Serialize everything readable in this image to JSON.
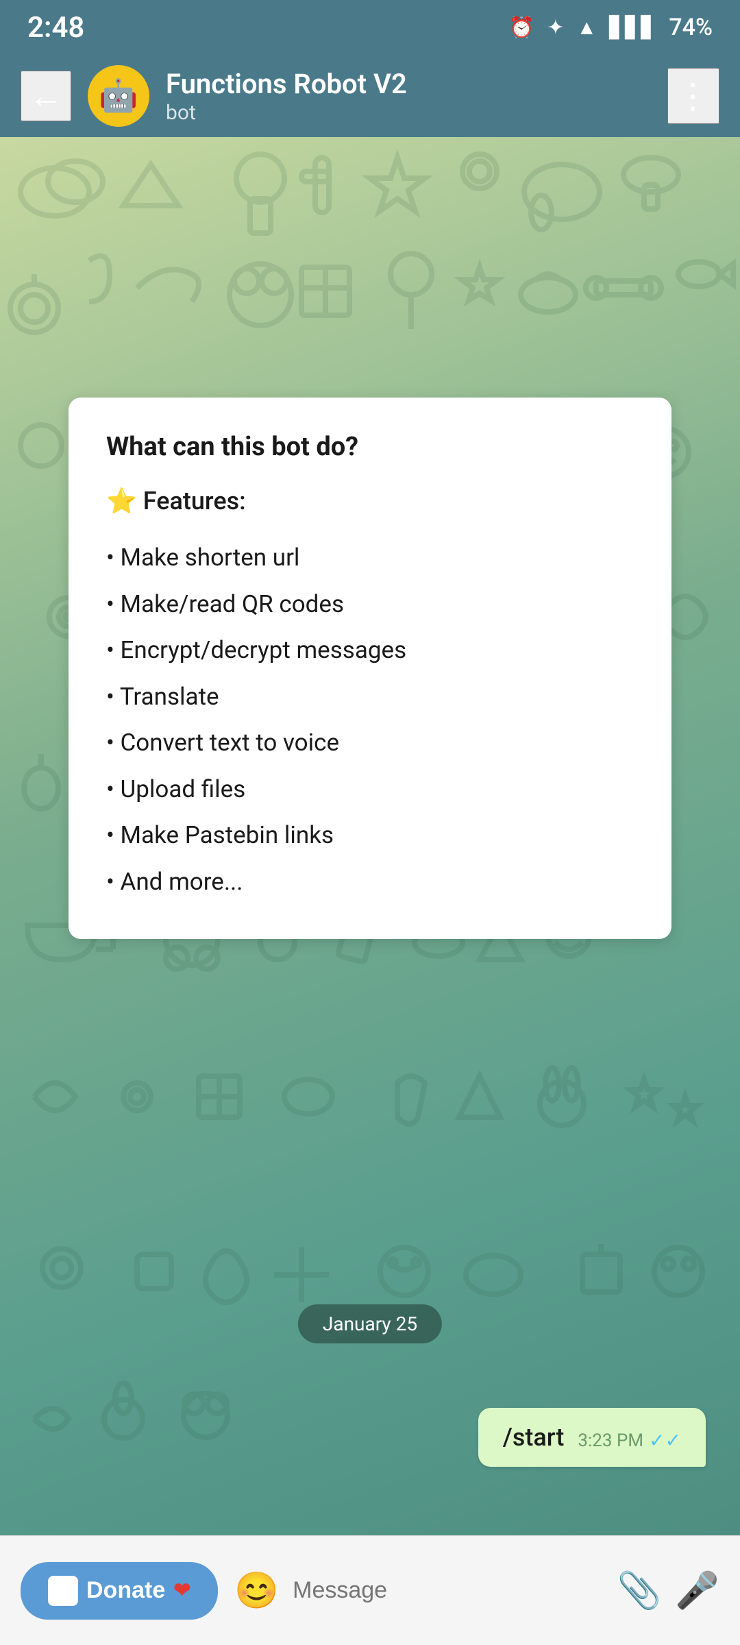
{
  "statusBar": {
    "time": "2:48",
    "battery": "74%"
  },
  "header": {
    "botName": "Functions Robot V2",
    "botStatus": "bot",
    "backLabel": "←",
    "menuLabel": "⋮"
  },
  "introCard": {
    "title": "What can this bot do?",
    "featuresHeader": "⭐ Features:",
    "features": [
      "Make shorten url",
      "Make/read QR codes",
      "Encrypt/decrypt messages",
      "Translate",
      "Convert text to voice",
      "Upload files",
      "Make Pastebin links",
      "And more..."
    ]
  },
  "dateDivider": "January 25",
  "userMessage": {
    "text": "/start",
    "time": "3:23 PM",
    "readIcon": "✓✓"
  },
  "bottomBar": {
    "donateLabel": "Donate",
    "messagePlaceholder": "Message",
    "stickerIcon": "😊",
    "attachIcon": "📎",
    "micIcon": "🎤"
  }
}
